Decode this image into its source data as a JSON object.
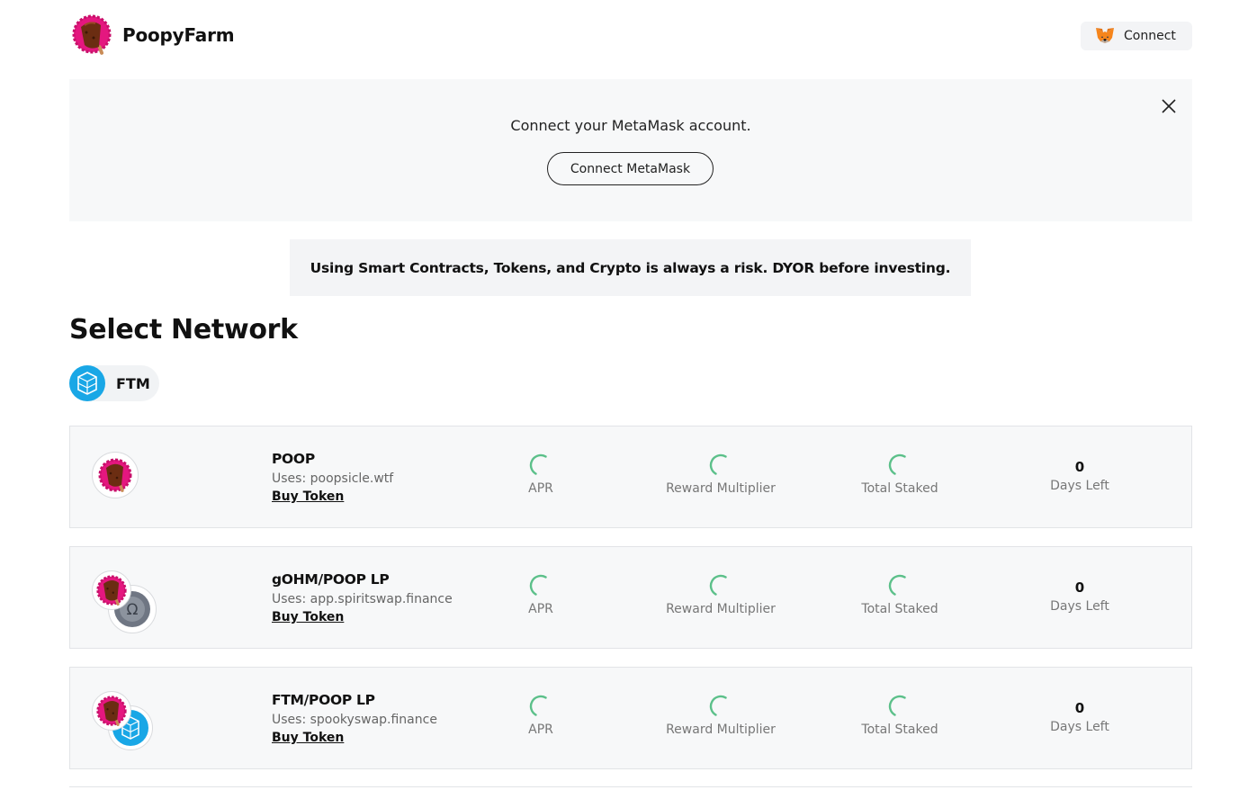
{
  "header": {
    "brand": "PoopyFarm",
    "connect_label": "Connect",
    "connect_icon": "metamask-fox-icon"
  },
  "banner": {
    "message": "Connect your MetaMask account.",
    "button_label": "Connect MetaMask",
    "close_icon": "close-icon"
  },
  "warning": {
    "text": "Using Smart Contracts, Tokens, and Crypto is always a risk. DYOR before investing."
  },
  "network_section": {
    "title": "Select Network",
    "selected": "FTM",
    "icon": "fantom-icon"
  },
  "colors": {
    "accent_green": "#5cc08a",
    "fantom_blue": "#19a7e6",
    "poop_pink": "#e4177f",
    "poop_brown": "#6b2d12"
  },
  "farms": [
    {
      "name": "POOP",
      "uses": "Uses: poopsicle.wtf",
      "buy_label": "Buy Token",
      "apr_label": "APR",
      "multiplier_label": "Reward Multiplier",
      "staked_label": "Total Staked",
      "days_value": "0",
      "days_label": "Days Left"
    },
    {
      "name": "gOHM/POOP LP",
      "uses": "Uses: app.spiritswap.finance",
      "buy_label": "Buy Token",
      "apr_label": "APR",
      "multiplier_label": "Reward Multiplier",
      "staked_label": "Total Staked",
      "days_value": "0",
      "days_label": "Days Left"
    },
    {
      "name": "FTM/POOP LP",
      "uses": "Uses: spookyswap.finance",
      "buy_label": "Buy Token",
      "apr_label": "APR",
      "multiplier_label": "Reward Multiplier",
      "staked_label": "Total Staked",
      "days_value": "0",
      "days_label": "Days Left"
    }
  ]
}
